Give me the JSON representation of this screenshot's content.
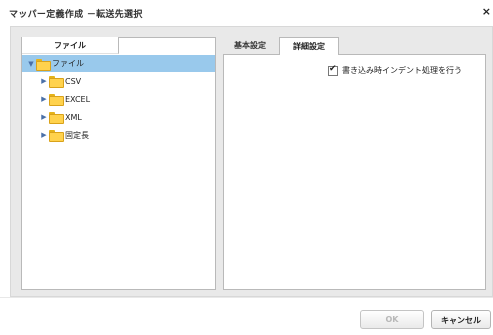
{
  "dialog": {
    "title": "マッパー定義作成 －転送先選択",
    "close_glyph": "×"
  },
  "tree": {
    "tab_label": "ファイル",
    "root": {
      "label": "ファイル",
      "expanded": true,
      "selected": true
    },
    "children": [
      {
        "label": "CSV"
      },
      {
        "label": "EXCEL"
      },
      {
        "label": "XML"
      },
      {
        "label": "固定長"
      }
    ]
  },
  "settings": {
    "tabs": [
      {
        "label": "基本設定",
        "active": false
      },
      {
        "label": "詳細設定",
        "active": true
      }
    ],
    "indent_option": {
      "label": "書き込み時インデント処理を行う",
      "checked": true
    }
  },
  "footer": {
    "ok_label": "OK",
    "ok_enabled": false,
    "cancel_label": "キャンセル"
  },
  "colors": {
    "selection": "#99c9ec",
    "folder": "#ffd24d",
    "panel_bg": "#e9e9e9"
  }
}
